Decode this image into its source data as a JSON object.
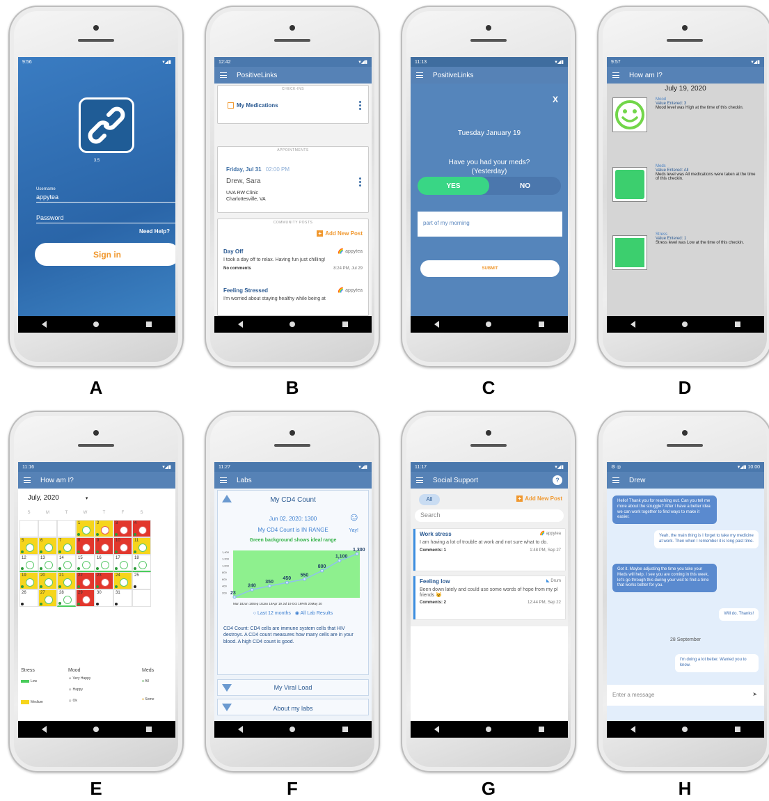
{
  "panels": {
    "A": {
      "label": "A",
      "status_time": "9:56",
      "version": "3.5",
      "username_label": "Username",
      "username_value": "appytea",
      "password_placeholder": "Password",
      "need_help": "Need Help?",
      "sign_in": "Sign in"
    },
    "B": {
      "label": "B",
      "status_time": "12:42",
      "title": "PositiveLinks",
      "checkins_header": "CHECK-INS",
      "my_medications": "My Medications",
      "appointments_header": "APPOINTMENTS",
      "appt_date": "Friday, Jul 31",
      "appt_time": "02:00 PM",
      "appt_person": "Drew, Sara",
      "appt_place1": "UVA RW Clinic",
      "appt_place2": "Charlottesville, VA",
      "community_header": "COMMUNITY POSTS",
      "add_new_post": "Add New Post",
      "posts": [
        {
          "title": "Day Off",
          "author": "appytea",
          "body": "I took a day off to relax. Having fun just chilling!",
          "comments": "No comments",
          "time": "8:24 PM, Jul 29"
        },
        {
          "title": "Feeling Stressed",
          "author": "appytea",
          "body": "I'm worried about staying healthy while being at"
        }
      ]
    },
    "C": {
      "label": "C",
      "status_time": "11:13",
      "title": "PositiveLinks",
      "close": "X",
      "date": "Tuesday January 19",
      "question1": "Have you had your meds?",
      "question2": "(Yesterday)",
      "yes": "YES",
      "no": "NO",
      "note": "part of my morning",
      "submit": "SUBMIT"
    },
    "D": {
      "label": "D",
      "status_time": "9:57",
      "title": "How am I?",
      "date": "July 19, 2020",
      "items": [
        {
          "title": "Mood",
          "value": "Value Entered: 3",
          "desc": "Mood level was High at the time of this checkin."
        },
        {
          "title": "Meds",
          "value": "Value Entered: All",
          "desc": "Meds level was All medications were taken at the time of this checkin."
        },
        {
          "title": "Stress",
          "value": "Value Entered: 1",
          "desc": "Stress level was Low at the time of this checkin."
        }
      ]
    },
    "E": {
      "label": "E",
      "status_time": "11:16",
      "title": "How am I?",
      "month": "July, 2020",
      "weekdays": [
        "S",
        "M",
        "T",
        "W",
        "T",
        "F",
        "S"
      ],
      "legend_stress": "Stress",
      "legend_mood": "Mood",
      "legend_meds": "Meds",
      "stress_low": "Low",
      "stress_medium": "Medium",
      "mood_very_happy": "Very Happy",
      "mood_happy": "Happy",
      "mood_ok": "Ok",
      "meds_all": "All",
      "meds_some": "Some"
    },
    "F": {
      "label": "F",
      "status_time": "11:27",
      "title": "Labs",
      "cd4_title": "My CD4 Count",
      "cd4_date_value": "Jun 02, 2020: 1300",
      "cd4_in_range": "My CD4 Count is IN RANGE",
      "yay": "Yay!",
      "green_note": "Green background shows ideal range",
      "last12": "Last 12 months",
      "all_results": "All Lab Results",
      "cd4_description": "CD4 Count: CD4 cells are immune system cells that HIV destroys. A CD4 count measures how many cells are in your blood. A high CD4 count is good.",
      "viral_load": "My Viral Load",
      "about_labs": "About my labs",
      "chart_points": [
        23,
        240,
        350,
        450,
        550,
        800,
        1100,
        1300
      ],
      "chart_ticks": [
        "1,400",
        "1,200",
        "1,000",
        "800",
        "600",
        "400",
        "200"
      ],
      "chart_xlabels": "Mar 18Jun 18Sep 18Jan 19Apr 19 Jul 19 Oct 19Feb 20May 20"
    },
    "G": {
      "label": "G",
      "status_time": "11:17",
      "title": "Social Support",
      "all": "All",
      "add_new_post": "Add New Post",
      "search": "Search",
      "posts": [
        {
          "title": "Work stress",
          "author": "appytea",
          "body": "I am having a lot of trouble at work and not sure what to do.",
          "comments": "Comments: 1",
          "time": "1:48 PM, Sep 27"
        },
        {
          "title": "Feeling low",
          "author": "Drum",
          "body": "Been down lately and could use some words of hope from my pl friends 😺",
          "comments": "Comments: 2",
          "time": "12:44 PM, Sep 22"
        }
      ]
    },
    "H": {
      "label": "H",
      "status_time": "10:00",
      "title": "Drew",
      "messages": [
        "Hello! Thank you for reaching out. Can you tell me more about the struggle? After I have a better idea we can work together to find ways to make it easier.",
        "Yeah, the main thing is I forget to take my medicine at work. Then when I remember it is long past time.",
        "Got it. Maybe adjusting the time you take your Meds will help. I see you are coming in this week, let's go through this during your visit to find a time that works better for you.",
        "Will do. Thanks!",
        "I'm doing a lot better. Wanted you to know."
      ],
      "date_divider": "28 September",
      "input_placeholder": "Enter a message"
    }
  },
  "colors": {
    "appbar": "#5682b6",
    "accent_orange": "#f0982f",
    "green": "#3ccf6e",
    "red": "#e2372c",
    "yellow": "#f6d51c"
  }
}
